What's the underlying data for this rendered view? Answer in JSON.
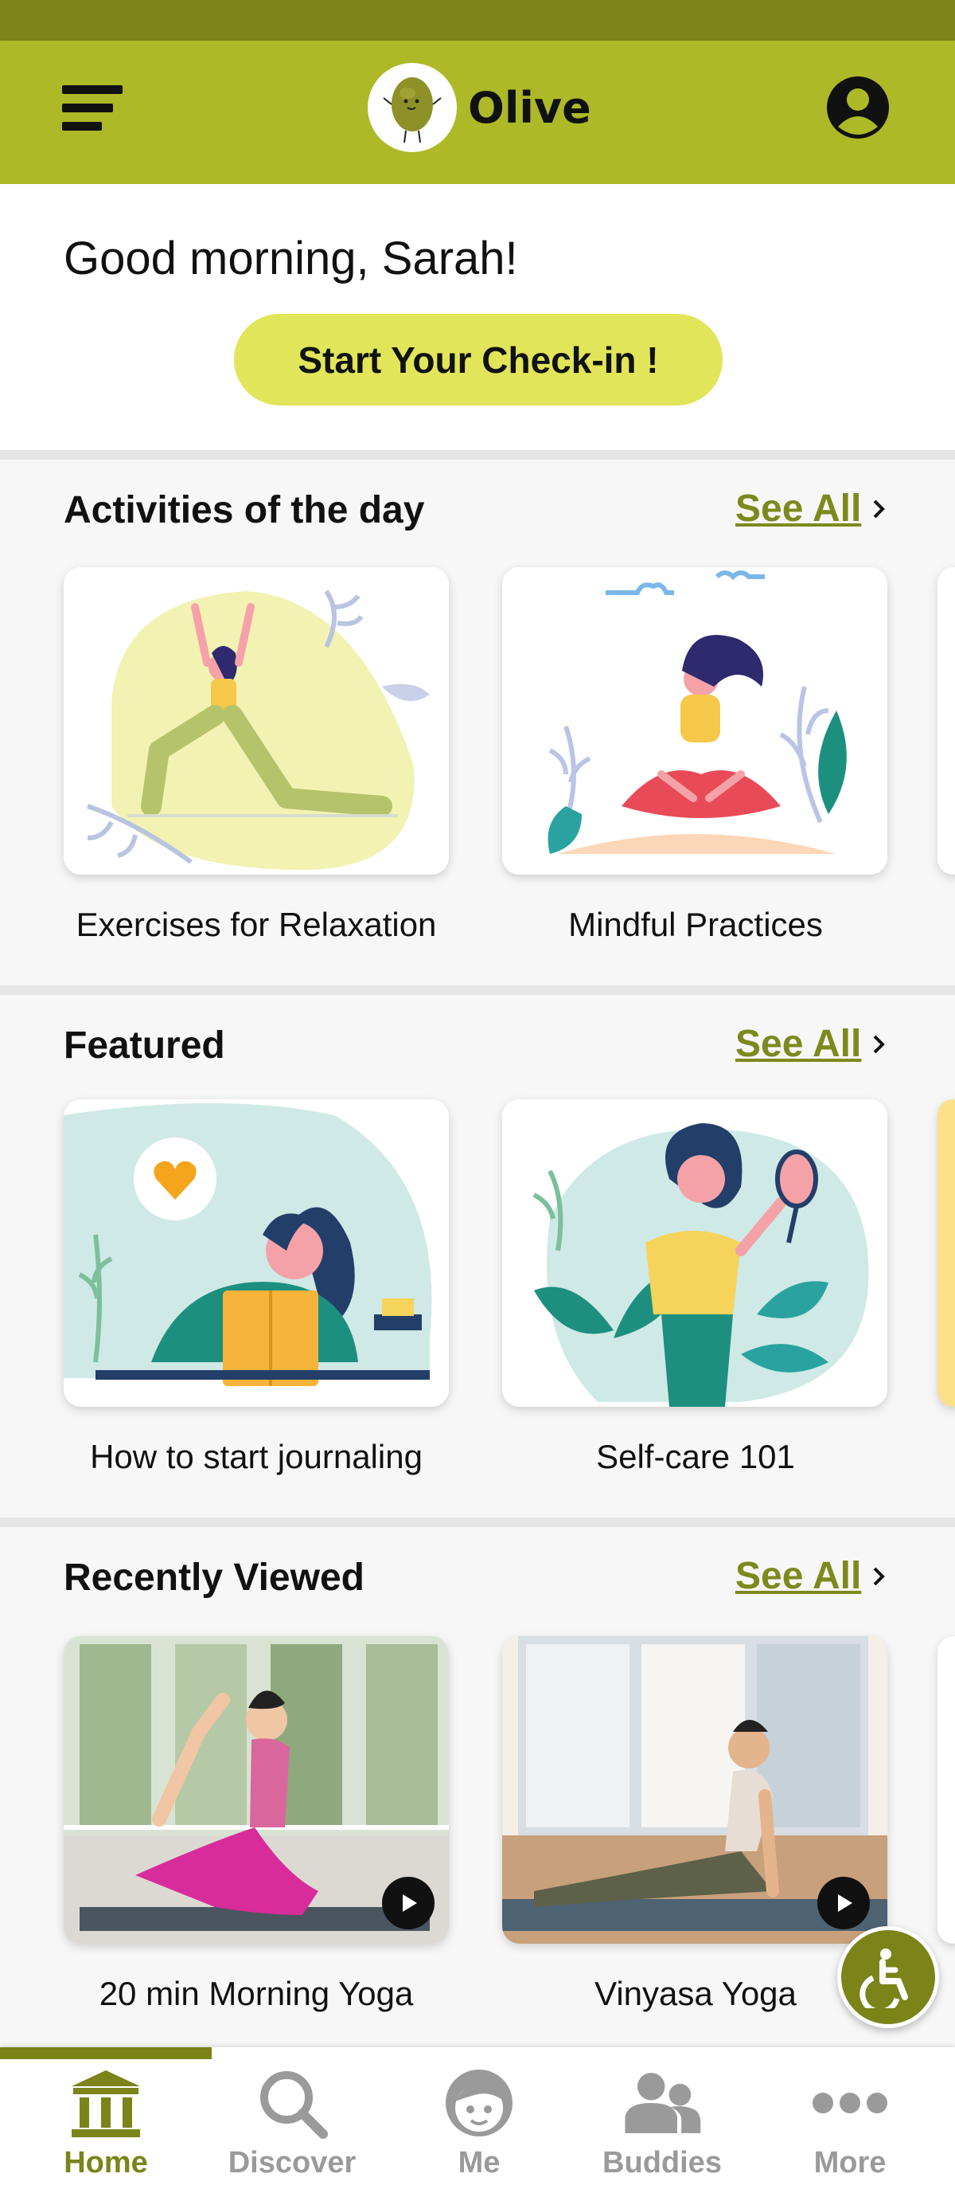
{
  "app": {
    "title": "Olive"
  },
  "greeting": {
    "text": "Good morning, Sarah!",
    "checkin_label": "Start Your Check-in !"
  },
  "sections": [
    {
      "title": "Activities of the day",
      "see_all": "See All",
      "cards": [
        {
          "label": "Exercises for Relaxation",
          "image": "woman-yoga-lunge-illustration"
        },
        {
          "label": "Mindful Practices",
          "image": "woman-meditating-illustration"
        }
      ]
    },
    {
      "title": "Featured",
      "see_all": "See All",
      "cards": [
        {
          "label": "How to start journaling",
          "image": "woman-writing-journal-illustration"
        },
        {
          "label": "Self-care 101",
          "image": "woman-holding-mirror-illustration"
        }
      ]
    },
    {
      "title": "Recently Viewed",
      "see_all": "See All",
      "cards": [
        {
          "label": "20 min Morning Yoga",
          "image": "yoga-photo-stretch"
        },
        {
          "label": "Vinyasa Yoga",
          "image": "yoga-photo-cobra"
        }
      ]
    }
  ],
  "tabs": [
    {
      "label": "Home",
      "icon": "home-icon",
      "active": true
    },
    {
      "label": "Discover",
      "icon": "search-icon",
      "active": false
    },
    {
      "label": "Me",
      "icon": "face-icon",
      "active": false
    },
    {
      "label": "Buddies",
      "icon": "people-icon",
      "active": false
    },
    {
      "label": "More",
      "icon": "more-dots-icon",
      "active": false
    }
  ],
  "colors": {
    "brand": "#adb927",
    "brand_dark": "#7a8419",
    "accent_button": "#e1e559",
    "link": "#7c8a1d"
  }
}
